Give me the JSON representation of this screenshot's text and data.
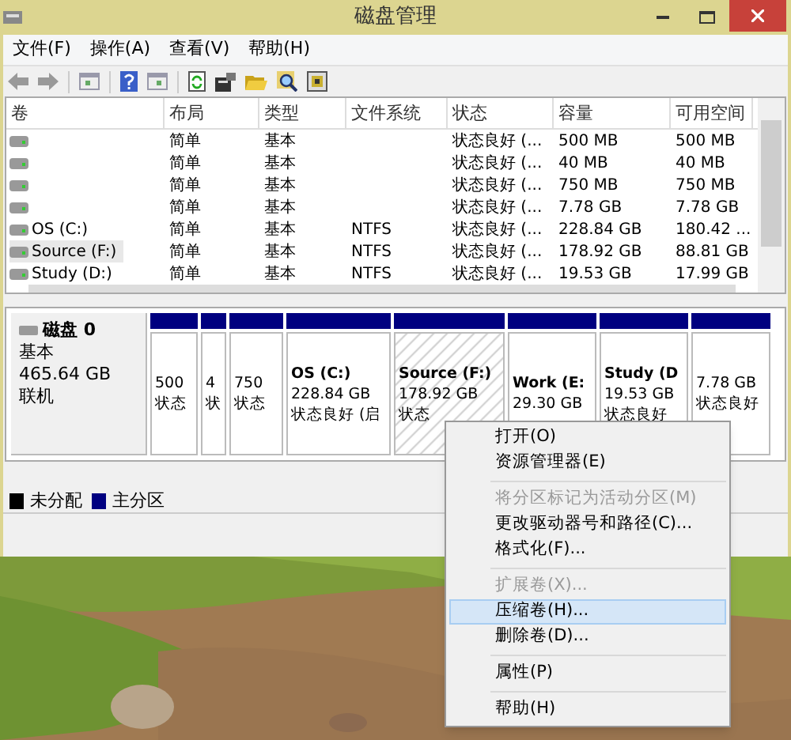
{
  "window": {
    "title": "磁盘管理"
  },
  "menu": [
    "文件(F)",
    "操作(A)",
    "查看(V)",
    "帮助(H)"
  ],
  "volume_table": {
    "columns": [
      "卷",
      "布局",
      "类型",
      "文件系统",
      "状态",
      "容量",
      "可用空间"
    ],
    "rows": [
      {
        "volume": "",
        "layout": "简单",
        "type": "基本",
        "file_system": "",
        "status": "状态良好 (...",
        "capacity": "500 MB",
        "free_space": "500 MB",
        "selected": false
      },
      {
        "volume": "",
        "layout": "简单",
        "type": "基本",
        "file_system": "",
        "status": "状态良好 (...",
        "capacity": "40 MB",
        "free_space": "40 MB",
        "selected": false
      },
      {
        "volume": "",
        "layout": "简单",
        "type": "基本",
        "file_system": "",
        "status": "状态良好 (...",
        "capacity": "750 MB",
        "free_space": "750 MB",
        "selected": false
      },
      {
        "volume": "",
        "layout": "简单",
        "type": "基本",
        "file_system": "",
        "status": "状态良好 (...",
        "capacity": "7.78 GB",
        "free_space": "7.78 GB",
        "selected": false
      },
      {
        "volume": "OS (C:)",
        "layout": "简单",
        "type": "基本",
        "file_system": "NTFS",
        "status": "状态良好 (...",
        "capacity": "228.84 GB",
        "free_space": "180.42 ...",
        "selected": false
      },
      {
        "volume": "Source (F:)",
        "layout": "简单",
        "type": "基本",
        "file_system": "NTFS",
        "status": "状态良好 (...",
        "capacity": "178.92 GB",
        "free_space": "88.81 GB",
        "selected": true
      },
      {
        "volume": "Study (D:)",
        "layout": "简单",
        "type": "基本",
        "file_system": "NTFS",
        "status": "状态良好 (...",
        "capacity": "19.53 GB",
        "free_space": "17.99 GB",
        "selected": false
      }
    ]
  },
  "disk": {
    "name": "磁盘 0",
    "type": "基本",
    "size": "465.64 GB",
    "status": "联机",
    "partitions": [
      {
        "lines": [
          "500",
          "状态"
        ],
        "selected": false
      },
      {
        "lines": [
          "4",
          "状"
        ],
        "selected": false
      },
      {
        "lines": [
          "750",
          "状态"
        ],
        "selected": false
      },
      {
        "name": "OS (C:)",
        "lines": [
          "228.84 GB",
          "状态良好 (启"
        ],
        "selected": false
      },
      {
        "name": "Source (F:)",
        "lines": [
          "178.92 GB",
          "状态"
        ],
        "selected": true
      },
      {
        "name": "Work (E:",
        "lines": [
          "29.30 GB"
        ],
        "selected": false
      },
      {
        "name": "Study (D",
        "lines": [
          "19.53 GB",
          "状态良好"
        ],
        "selected": false
      },
      {
        "lines": [
          "7.78 GB",
          "状态良好"
        ],
        "selected": false
      }
    ]
  },
  "legend": [
    {
      "label": "未分配",
      "color": "#000000"
    },
    {
      "label": "主分区",
      "color": "#000080"
    }
  ],
  "context_menu": [
    {
      "kind": "item",
      "label": "打开(O)",
      "disabled": false,
      "selected": false
    },
    {
      "kind": "item",
      "label": "资源管理器(E)",
      "disabled": false,
      "selected": false
    },
    {
      "kind": "separator"
    },
    {
      "kind": "item",
      "label": "将分区标记为活动分区(M)",
      "disabled": true,
      "selected": false
    },
    {
      "kind": "item",
      "label": "更改驱动器号和路径(C)...",
      "disabled": false,
      "selected": false
    },
    {
      "kind": "item",
      "label": "格式化(F)...",
      "disabled": false,
      "selected": false
    },
    {
      "kind": "separator"
    },
    {
      "kind": "item",
      "label": "扩展卷(X)...",
      "disabled": true,
      "selected": false
    },
    {
      "kind": "item",
      "label": "压缩卷(H)...",
      "disabled": false,
      "selected": true
    },
    {
      "kind": "item",
      "label": "删除卷(D)...",
      "disabled": false,
      "selected": false
    },
    {
      "kind": "separator"
    },
    {
      "kind": "item",
      "label": "属性(P)",
      "disabled": false,
      "selected": false
    },
    {
      "kind": "separator"
    },
    {
      "kind": "item",
      "label": "帮助(H)",
      "disabled": false,
      "selected": false
    }
  ]
}
